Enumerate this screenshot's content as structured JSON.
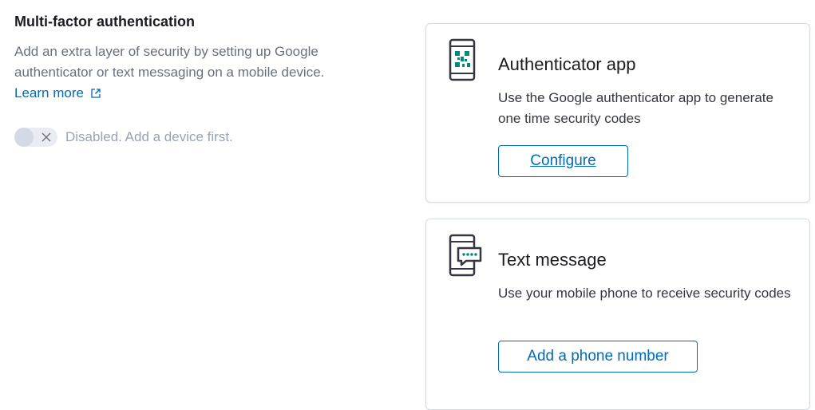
{
  "mfa": {
    "title": "Multi-factor authentication",
    "description": "Add an extra layer of security by setting up Google authenticator or text messaging on a mobile device.",
    "learn_more": "Learn more",
    "toggle_state": "off",
    "toggle_label": "Disabled. Add a device first."
  },
  "authenticator_card": {
    "icon": "qr-phone-icon",
    "title": "Authenticator app",
    "description": "Use the Google authenticator app to generate one time security codes",
    "button": "Configure"
  },
  "sms_card": {
    "icon": "sms-phone-icon",
    "title": "Text message",
    "description": "Use your mobile phone to receive security codes",
    "button": "Add a phone number"
  },
  "colors": {
    "link": "#006bb8",
    "qr_accent": "#00897b",
    "text": "#343741",
    "muted": "#69707d"
  }
}
